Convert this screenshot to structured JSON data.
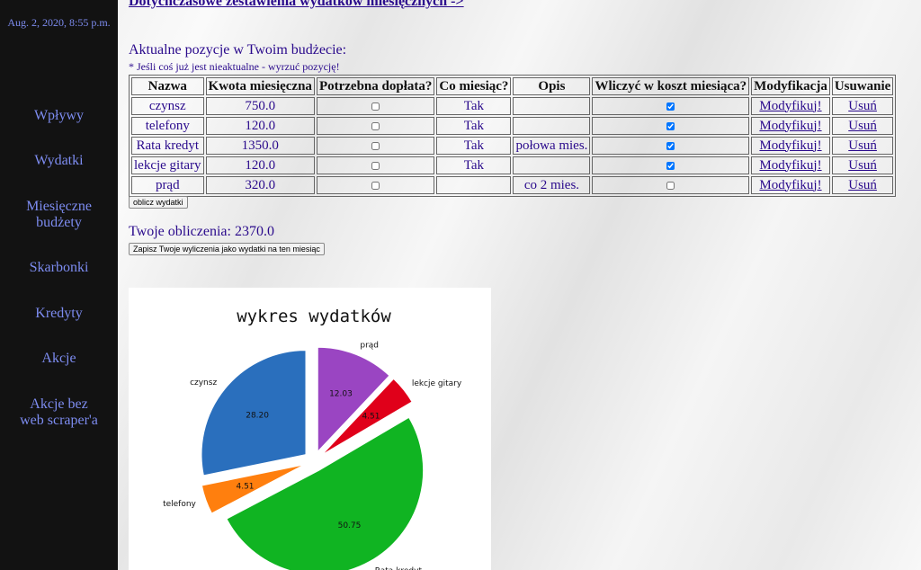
{
  "sidebar": {
    "datetime": "Aug. 2, 2020, 8:55 p.m.",
    "items": [
      {
        "lines": [
          "Wpływy"
        ]
      },
      {
        "lines": [
          "Wydatki"
        ]
      },
      {
        "lines": [
          "Miesięczne",
          "budżety"
        ]
      },
      {
        "lines": [
          "Skarbonki"
        ]
      },
      {
        "lines": [
          "Kredyty"
        ]
      },
      {
        "lines": [
          "Akcje"
        ]
      },
      {
        "lines": [
          "Akcje bez",
          "web scraper'a"
        ]
      }
    ]
  },
  "main": {
    "top_link": " Dotychczasowe zestawienia wydatków miesięcznych ->",
    "section_title": "Aktualne pozycje w Twoim budżecie:",
    "note": "* Jeśli coś już jest nieaktualne - wyrzuć pozycję!",
    "table": {
      "headers": [
        "Nazwa",
        "Kwota miesięczna",
        "Potrzebna dopłata?",
        "Co miesiąc?",
        "Opis",
        "Wliczyć w koszt miesiąca?",
        "Modyfikacja",
        "Usuwanie"
      ],
      "rows": [
        {
          "name": "czynsz",
          "amount": "750.0",
          "surcharge": false,
          "monthly": "Tak",
          "desc": "",
          "include": true,
          "modify": "Modyfikuj!",
          "delete": "Usuń"
        },
        {
          "name": "telefony",
          "amount": "120.0",
          "surcharge": false,
          "monthly": "Tak",
          "desc": "",
          "include": true,
          "modify": "Modyfikuj!",
          "delete": "Usuń"
        },
        {
          "name": "Rata kredyt",
          "amount": "1350.0",
          "surcharge": false,
          "monthly": "Tak",
          "desc": "połowa mies.",
          "include": true,
          "modify": "Modyfikuj!",
          "delete": "Usuń"
        },
        {
          "name": "lekcje gitary",
          "amount": "120.0",
          "surcharge": false,
          "monthly": "Tak",
          "desc": "",
          "include": true,
          "modify": "Modyfikuj!",
          "delete": "Usuń"
        },
        {
          "name": "prąd",
          "amount": "320.0",
          "surcharge": false,
          "monthly": "",
          "desc": "co 2 mies.",
          "include": false,
          "modify": "Modyfikuj!",
          "delete": "Usuń"
        }
      ]
    },
    "calc_button": "oblicz wydatki",
    "calc_label": "Twoje obliczenia:",
    "calc_value": "2370.0",
    "save_button": "Zapisz Twoje wyliczenia jako wydatki na ten miesiąc"
  },
  "chart_data": {
    "type": "pie",
    "title": "wykres wydatków",
    "labels": [
      "czynsz",
      "telefony",
      "Rata kredyt",
      "lekcje gitary",
      "prąd"
    ],
    "values": [
      28.2,
      4.51,
      50.75,
      4.51,
      12.03
    ],
    "colors": [
      "#2a6fbd",
      "#ff7f0e",
      "#10b422",
      "#e0001a",
      "#9a45c2"
    ],
    "explode": true
  }
}
